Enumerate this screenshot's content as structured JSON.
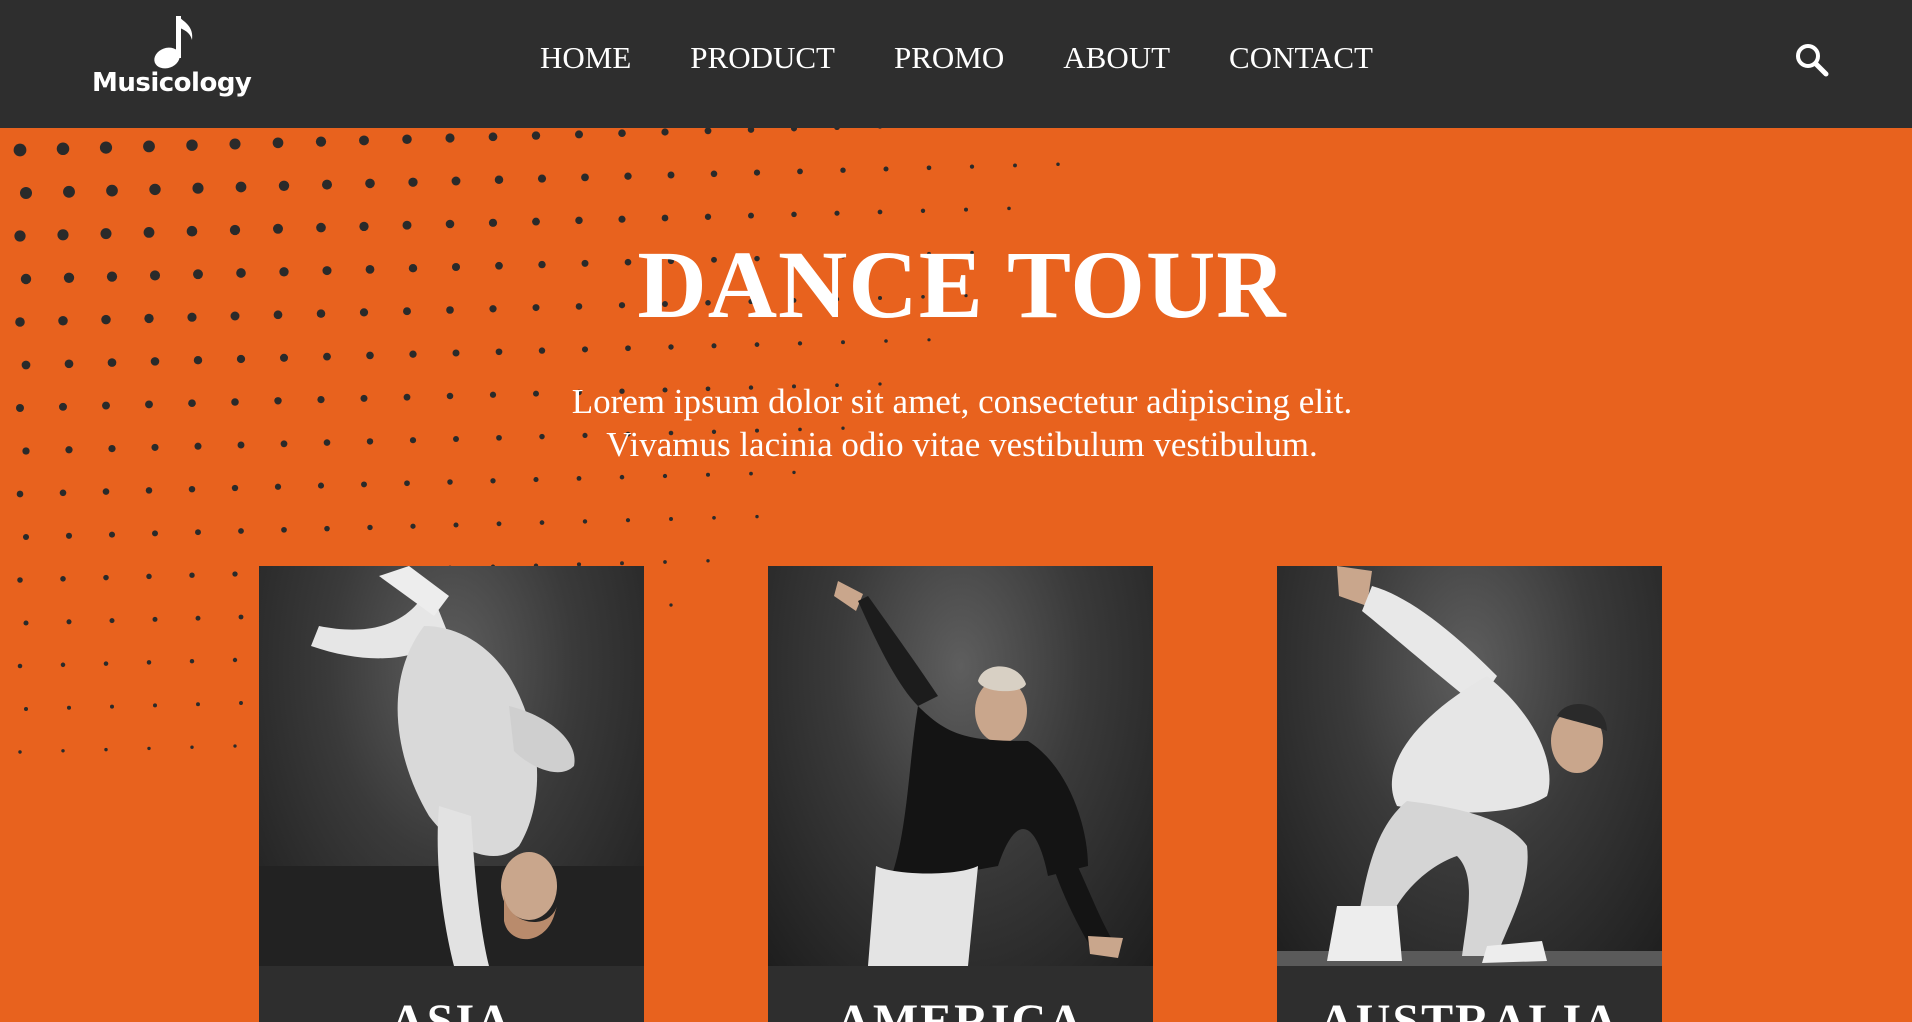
{
  "brand": {
    "logo_text": "Musicology",
    "logo_icon": "music-note-icon"
  },
  "nav": {
    "items": [
      {
        "label": "HOME"
      },
      {
        "label": "PRODUCT"
      },
      {
        "label": "PROMO"
      },
      {
        "label": "ABOUT"
      },
      {
        "label": "CONTACT"
      }
    ],
    "search_icon": "search-icon"
  },
  "hero": {
    "title": "DANCE TOUR",
    "text_line1": "Lorem ipsum dolor sit amet, consectetur adipiscing elit.",
    "text_line2": "Vivamus lacinia odio vitae vestibulum vestibulum."
  },
  "tours": [
    {
      "label": "ASIA"
    },
    {
      "label": "AMERICA"
    },
    {
      "label": "AUSTRALIA"
    }
  ],
  "colors": {
    "accent": "#E8621E",
    "dark": "#2E2E2E",
    "text": "#FFFFFF",
    "dots": "#2A2A2A"
  }
}
